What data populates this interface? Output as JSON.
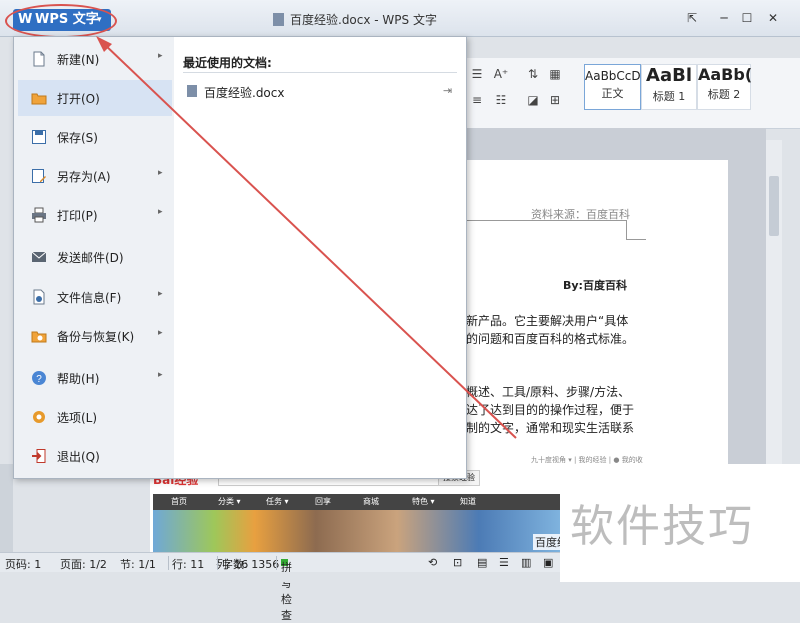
{
  "app": {
    "button_label": "WPS 文字",
    "logo_glyph": "W",
    "dropdown_glyph": "▾",
    "window_title": "百度经验.docx - WPS 文字"
  },
  "menu": {
    "items": [
      {
        "label": "新建(N)",
        "icon": "new-document-icon",
        "has_submenu": true
      },
      {
        "label": "打开(O)",
        "icon": "open-folder-icon",
        "has_submenu": false,
        "active": true
      },
      {
        "label": "保存(S)",
        "icon": "save-icon",
        "has_submenu": false
      },
      {
        "label": "另存为(A)",
        "icon": "save-as-icon",
        "has_submenu": true
      },
      {
        "label": "打印(P)",
        "icon": "printer-icon",
        "has_submenu": true
      },
      {
        "label": "发送邮件(D)",
        "icon": "mail-icon",
        "has_submenu": false
      },
      {
        "label": "文件信息(F)",
        "icon": "file-info-icon",
        "has_submenu": true
      },
      {
        "label": "备份与恢复(K)",
        "icon": "backup-icon",
        "has_submenu": true
      },
      {
        "label": "帮助(H)",
        "icon": "help-icon",
        "has_submenu": true
      },
      {
        "label": "选项(L)",
        "icon": "gear-icon",
        "has_submenu": false
      },
      {
        "label": "退出(Q)",
        "icon": "exit-icon",
        "has_submenu": false
      }
    ],
    "submenu_glyph": "▸"
  },
  "recent": {
    "title": "最近使用的文档:",
    "files": [
      {
        "name": "百度经验.docx",
        "pin_glyph": "⇥"
      }
    ]
  },
  "styles": [
    {
      "sample": "AaBbCcD",
      "name": "正文"
    },
    {
      "sample": "AaBl",
      "name": "标题 1"
    },
    {
      "sample": "AaBb(",
      "name": "标题 2"
    }
  ],
  "document": {
    "source_line": "资料来源：百度百科",
    "byline": "By:百度百科",
    "para1": [
      "新产品。它主要解决用户“具体",
      "的问题和百度百科的格式标准。"
    ],
    "para2": [
      "概述、工具/原料、步骤/方法、",
      "达了达到目的的操作过程，便于",
      "制的文字，通常和现实生活联系"
    ],
    "mini_links": "九十度视角 ▾  |  我的经验  |  ● 我的收"
  },
  "embedded_image": {
    "logo": "Bai经验",
    "search_button": "搜索经验",
    "nav": [
      "首页",
      "分类 ▾",
      "任务 ▾",
      "回享",
      "商城",
      "特色 ▾",
      "知道"
    ],
    "caption": "百度经"
  },
  "statusbar": {
    "page_num": "页码: 1",
    "page": "页面: 1/2",
    "section": "节: 1/1",
    "row": "行: 11",
    "col": "列: 16",
    "words": "字数: 1356",
    "spellcheck": "拼写检查"
  },
  "watermark": "软件技巧",
  "colors": {
    "accent": "#2f6fc3",
    "annotation_red": "#d9534f",
    "menu_active": "#d7e3f3"
  }
}
